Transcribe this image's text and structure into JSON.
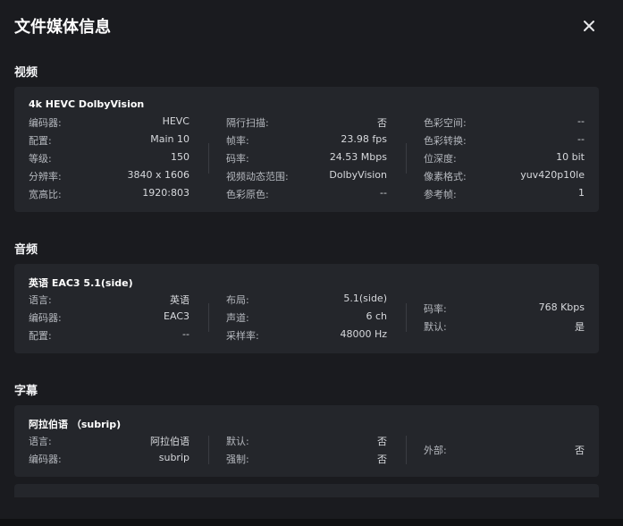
{
  "dialog": {
    "title": "文件媒体信息"
  },
  "video": {
    "section_title": "视频",
    "card_title": "4k HEVC DolbyVision",
    "col1": [
      {
        "k": "编码器:",
        "v": "HEVC"
      },
      {
        "k": "配置:",
        "v": "Main 10"
      },
      {
        "k": "等级:",
        "v": "150"
      },
      {
        "k": "分辨率:",
        "v": "3840 x 1606"
      },
      {
        "k": "宽高比:",
        "v": "1920:803"
      }
    ],
    "col2": [
      {
        "k": "隔行扫描:",
        "v": "否"
      },
      {
        "k": "帧率:",
        "v": "23.98 fps"
      },
      {
        "k": "码率:",
        "v": "24.53 Mbps"
      },
      {
        "k": "视频动态范围:",
        "v": "DolbyVision"
      },
      {
        "k": "色彩原色:",
        "v": "--"
      }
    ],
    "col3": [
      {
        "k": "色彩空间:",
        "v": "--"
      },
      {
        "k": "色彩转换:",
        "v": "--"
      },
      {
        "k": "位深度:",
        "v": "10 bit"
      },
      {
        "k": "像素格式:",
        "v": "yuv420p10le"
      },
      {
        "k": "参考帧:",
        "v": "1"
      }
    ]
  },
  "audio": {
    "section_title": "音频",
    "card_title": "英语 EAC3 5.1(side)",
    "col1": [
      {
        "k": "语言:",
        "v": "英语"
      },
      {
        "k": "编码器:",
        "v": "EAC3"
      },
      {
        "k": "配置:",
        "v": "--"
      }
    ],
    "col2": [
      {
        "k": "布局:",
        "v": "5.1(side)"
      },
      {
        "k": "声道:",
        "v": "6 ch"
      },
      {
        "k": "采样率:",
        "v": "48000 Hz"
      }
    ],
    "col3": [
      {
        "k": "码率:",
        "v": "768 Kbps"
      },
      {
        "k": "默认:",
        "v": "是"
      }
    ]
  },
  "subtitle": {
    "section_title": "字幕",
    "card_title": "阿拉伯语 （subrip)",
    "col1": [
      {
        "k": "语言:",
        "v": "阿拉伯语"
      },
      {
        "k": "编码器:",
        "v": "subrip"
      }
    ],
    "col2": [
      {
        "k": "默认:",
        "v": "否"
      },
      {
        "k": "强制:",
        "v": "否"
      }
    ],
    "col3": [
      {
        "k": "外部:",
        "v": "否"
      }
    ]
  },
  "colors": {
    "background": "#1a1b1f",
    "card": "#24262b",
    "text": "#d7d9dd",
    "label": "#b5b8be"
  },
  "icons": {
    "close": "close-icon"
  }
}
